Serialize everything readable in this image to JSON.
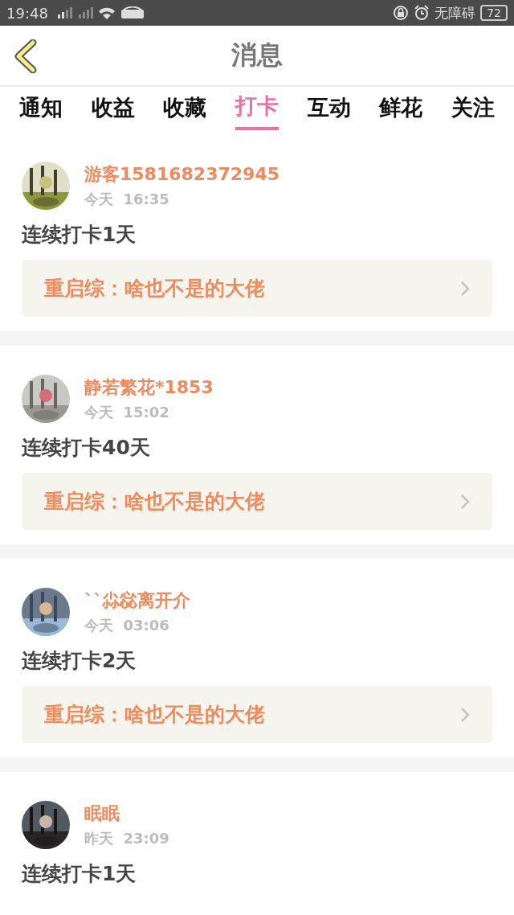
{
  "status_bar": {
    "time": "19:48",
    "accessibility": "无障碍",
    "battery": "72"
  },
  "header": {
    "title": "消息"
  },
  "tabs": [
    {
      "label": "通知",
      "selected": false
    },
    {
      "label": "收益",
      "selected": false
    },
    {
      "label": "收藏",
      "selected": false
    },
    {
      "label": "打卡",
      "selected": true
    },
    {
      "label": "互动",
      "selected": false
    },
    {
      "label": "鲜花",
      "selected": false
    },
    {
      "label": "关注",
      "selected": false
    }
  ],
  "items": [
    {
      "user": "游客1581682372945",
      "time": "今天  16:35",
      "text": "连续打卡1天",
      "group": "重启综：啥也不是的大佬"
    },
    {
      "user": "静若繁花*1853",
      "time": "今天  15:02",
      "text": "连续打卡40天",
      "group": "重启综：啥也不是的大佬"
    },
    {
      "user": "``尛惢离开介",
      "time": "今天  03:06",
      "text": "连续打卡2天",
      "group": "重启综：啥也不是的大佬"
    },
    {
      "user": "眠眠",
      "time": "昨天  23:09",
      "text": "连续打卡1天"
    }
  ]
}
